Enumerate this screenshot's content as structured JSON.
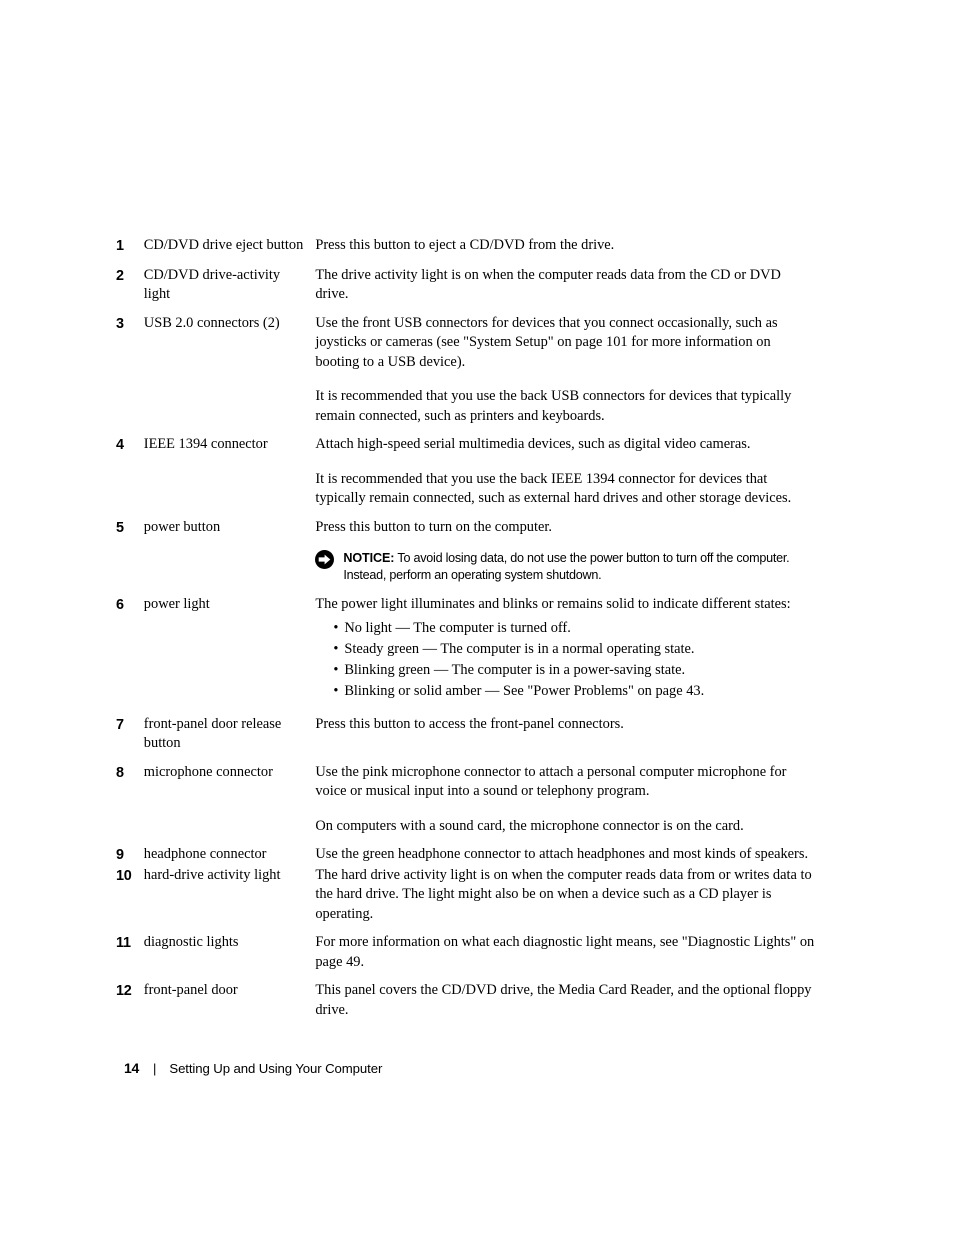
{
  "document": {
    "rows": [
      {
        "num": "1",
        "label": "CD/DVD drive eject button",
        "paragraphs": [
          "Press this button to eject a CD/DVD from the drive."
        ]
      },
      {
        "num": "2",
        "label": "CD/DVD drive-activity light",
        "paragraphs": [
          "The drive activity light is on when the computer reads data from the CD or DVD drive."
        ]
      },
      {
        "num": "3",
        "label": "USB 2.0 connectors (2)",
        "paragraphs": [
          "Use the front USB connectors for devices that you connect occasionally, such as joysticks or cameras (see \"System Setup\" on page 101 for more information on booting to a USB device).",
          "It is recommended that you use the back USB connectors for devices that typically remain connected, such as printers and keyboards."
        ]
      },
      {
        "num": "4",
        "label": "IEEE 1394 connector",
        "paragraphs": [
          "Attach high-speed serial multimedia devices, such as digital video cameras.",
          "It is recommended that you use the back IEEE 1394 connector for devices that typically remain connected, such as external hard drives and other storage devices."
        ]
      },
      {
        "num": "5",
        "label": "power button",
        "paragraphs": [
          "Press this button to turn on the computer."
        ],
        "notice": {
          "icon": "notice-arrow-icon",
          "keyword": "NOTICE:",
          "text": " To avoid losing data, do not use the power button to turn off the computer. Instead, perform an operating system shutdown."
        }
      },
      {
        "num": "6",
        "label": "power light",
        "paragraphs": [
          "The power light illuminates and blinks or remains solid to indicate different states:"
        ],
        "bullets": [
          "No light — The computer is turned off.",
          "Steady green — The computer is in a normal operating state.",
          "Blinking green — The computer is in a power-saving state.",
          "Blinking or solid amber — See \"Power Problems\" on page 43."
        ]
      },
      {
        "num": "7",
        "label": "front-panel door release button",
        "paragraphs": [
          "Press this button to access the front-panel connectors."
        ]
      },
      {
        "num": "8",
        "label": "microphone connector",
        "paragraphs": [
          "Use the pink microphone connector to attach a personal computer microphone for voice or musical input into a sound or telephony program.",
          "On computers with a sound card, the microphone connector is on the card."
        ]
      },
      {
        "num": "9",
        "label": "headphone connector",
        "paragraphs": [
          "Use the green headphone connector to attach headphones and most kinds of speakers."
        ]
      },
      {
        "num": "10",
        "label": "hard-drive activity light",
        "paragraphs": [
          "The hard drive activity light is on when the computer reads data from or writes data to the hard drive. The light might also be on when a device such as a CD player is operating."
        ]
      },
      {
        "num": "11",
        "label": "diagnostic lights",
        "paragraphs": [
          "For more information on what each diagnostic light means, see \"Diagnostic Lights\" on page 49."
        ]
      },
      {
        "num": "12",
        "label": "front-panel door",
        "paragraphs": [
          "This panel covers the CD/DVD drive, the Media Card Reader, and the optional floppy drive."
        ]
      }
    ]
  },
  "footer": {
    "page_number": "14",
    "separator": "|",
    "section_title": "Setting Up and Using Your Computer"
  },
  "colors": {
    "text": "#000000",
    "background": "#ffffff"
  }
}
